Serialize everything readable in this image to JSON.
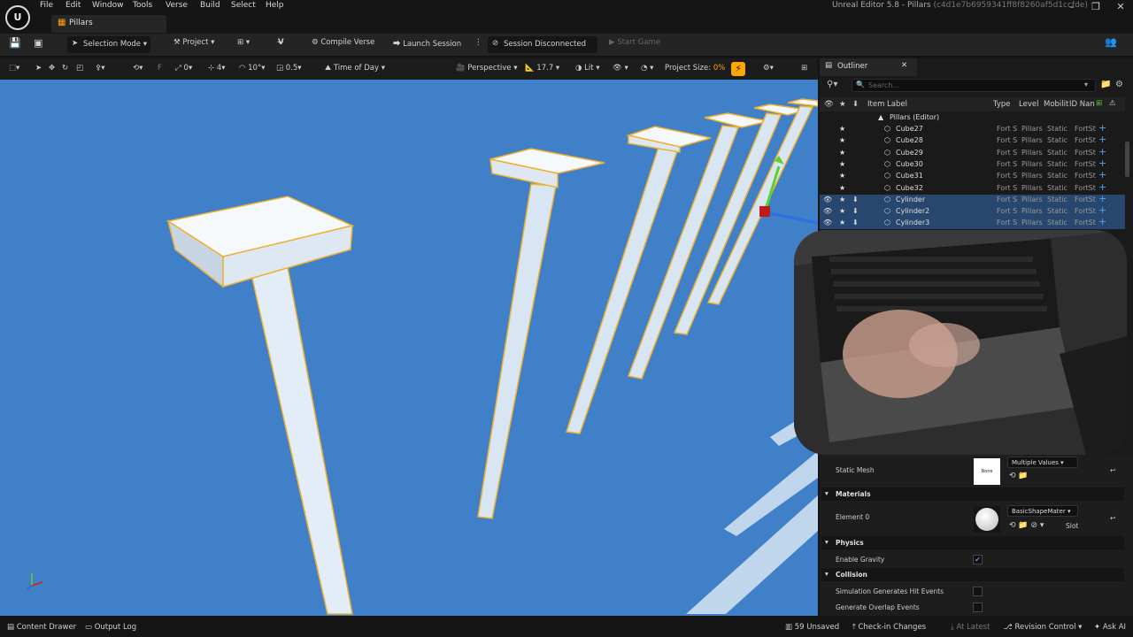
{
  "menu": [
    "File",
    "Edit",
    "Window",
    "Tools",
    "Verse",
    "Build",
    "Select",
    "Help"
  ],
  "window_title": "Unreal Editor 5.8 - Pillars",
  "window_subtitle": "(c4d1e7b6959341ff8f8260af5d1ccfde)",
  "logo": "U",
  "doc_tab": "Pillars",
  "toolbar": {
    "selection_mode": "Selection Mode",
    "project": "Project",
    "compile": "Compile Verse",
    "launch": "Launch Session",
    "session": "Session Disconnected",
    "start": "Start Game"
  },
  "viewport_toolbar": {
    "snap_rot": "0",
    "snap_count": "4",
    "snap_angle": "10°",
    "snap_scale": "0.5",
    "time_of_day": "Time of Day",
    "perspective": "Perspective",
    "fov": "17.7",
    "lit": "Lit",
    "project_size_label": "Project Size:",
    "project_size_value": "0%"
  },
  "outliner": {
    "tab": "Outliner",
    "search_placeholder": "Search...",
    "columns": {
      "label": "Item Label",
      "type": "Type",
      "level": "Level",
      "mobility": "Mobilit",
      "id": "ID Nan"
    },
    "group": "Pillars (Editor)",
    "rows": [
      {
        "name": "Cube27",
        "type": "Fort S",
        "level": "Pillars",
        "mobility": "Static",
        "id": "FortSt",
        "selected": false
      },
      {
        "name": "Cube28",
        "type": "Fort S",
        "level": "Pillars",
        "mobility": "Static",
        "id": "FortSt",
        "selected": false
      },
      {
        "name": "Cube29",
        "type": "Fort S",
        "level": "Pillars",
        "mobility": "Static",
        "id": "FortSt",
        "selected": false
      },
      {
        "name": "Cube30",
        "type": "Fort S",
        "level": "Pillars",
        "mobility": "Static",
        "id": "FortSt",
        "selected": false
      },
      {
        "name": "Cube31",
        "type": "Fort S",
        "level": "Pillars",
        "mobility": "Static",
        "id": "FortSt",
        "selected": false
      },
      {
        "name": "Cube32",
        "type": "Fort S",
        "level": "Pillars",
        "mobility": "Static",
        "id": "FortSt",
        "selected": false
      },
      {
        "name": "Cylinder",
        "type": "Fort S",
        "level": "Pillars",
        "mobility": "Static",
        "id": "FortSt",
        "selected": true
      },
      {
        "name": "Cylinder2",
        "type": "Fort S",
        "level": "Pillars",
        "mobility": "Static",
        "id": "FortSt",
        "selected": true
      },
      {
        "name": "Cylinder3",
        "type": "Fort S",
        "level": "Pillars",
        "mobility": "Static",
        "id": "FortSt",
        "selected": true
      }
    ]
  },
  "details": {
    "static_mesh_label": "Static Mesh",
    "static_mesh_thumb": "None",
    "static_mesh_value": "Multiple Values",
    "materials_section": "Materials",
    "element0_label": "Element 0",
    "element0_value": "BasicShapeMater",
    "slot_label": "Slot",
    "physics_section": "Physics",
    "gravity_label": "Enable Gravity",
    "gravity_checked": true,
    "collision_section": "Collision",
    "hit_events_label": "Simulation Generates Hit Events",
    "overlap_label": "Generate Overlap Events"
  },
  "status": {
    "content_drawer": "Content Drawer",
    "output_log": "Output Log",
    "unsaved": "59 Unsaved",
    "checkin": "Check-in Changes",
    "latest": "At Latest",
    "revision": "Revision Control",
    "ask": "Ask AI"
  },
  "colors": {
    "accent": "#ffa500",
    "selection_outline": "#f0b030",
    "viewport_bg": "#3f80c8",
    "selected_row": "#27476e"
  }
}
